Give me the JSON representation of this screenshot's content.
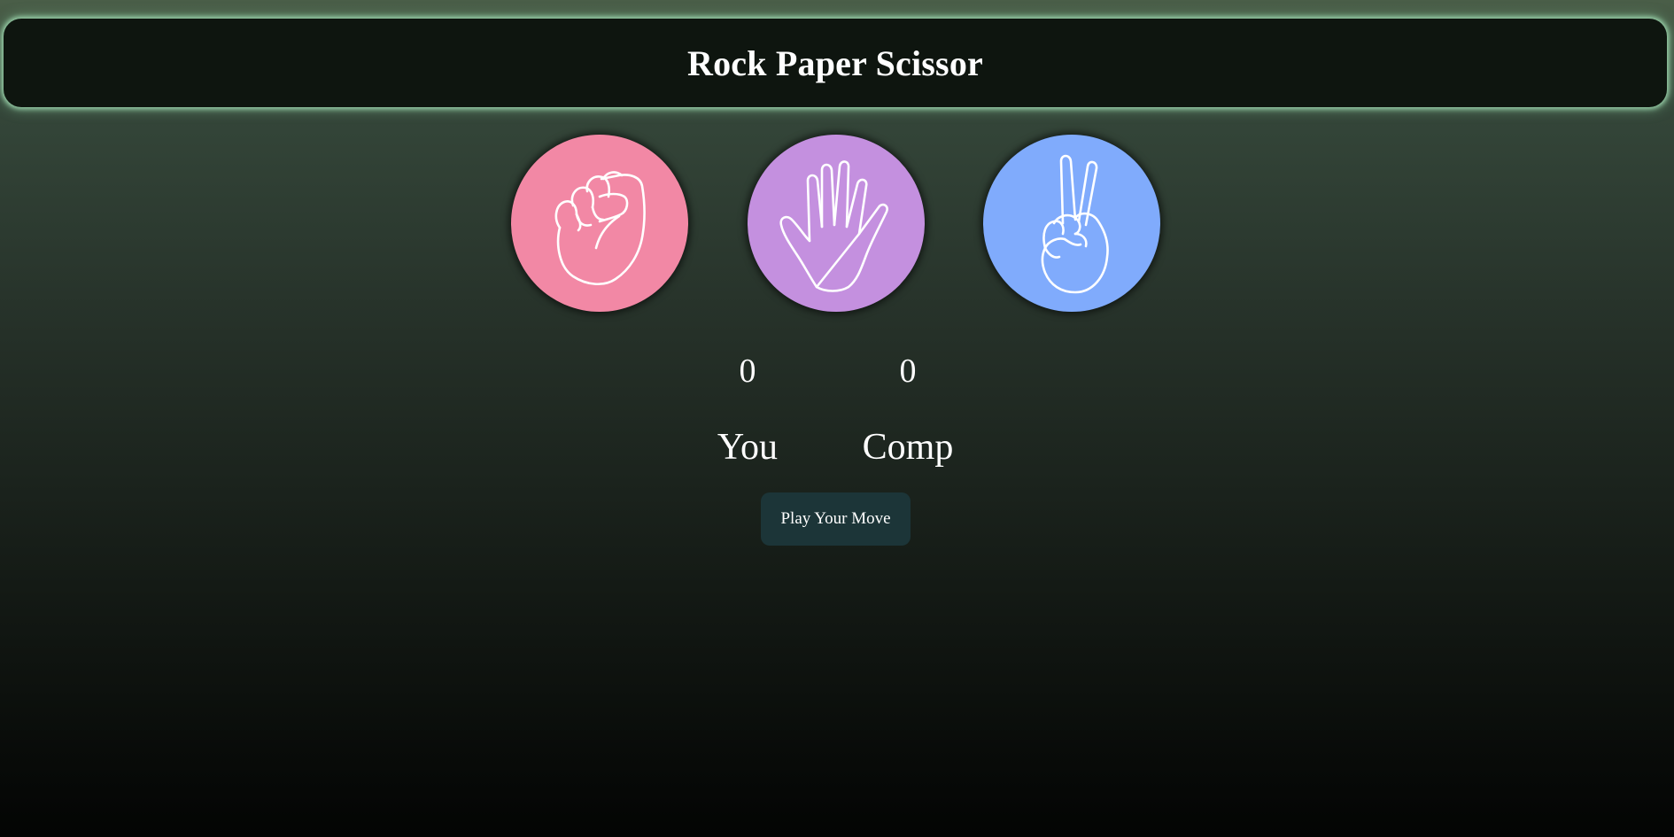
{
  "header": {
    "title": "Rock Paper Scissor"
  },
  "choices": [
    {
      "icon": "rock-fist-icon",
      "color": "#f288a5"
    },
    {
      "icon": "paper-hand-icon",
      "color": "#c490df"
    },
    {
      "icon": "scissor-hand-icon",
      "color": "#80abfc"
    }
  ],
  "scoreboard": {
    "user_score": "0",
    "comp_score": "0",
    "user_label": "You",
    "comp_label": "Comp"
  },
  "message": {
    "text": "Play Your Move",
    "background": "#1c3538"
  },
  "colors": {
    "header_bg": "#0e150f",
    "header_glow": "#9fd8b0"
  }
}
